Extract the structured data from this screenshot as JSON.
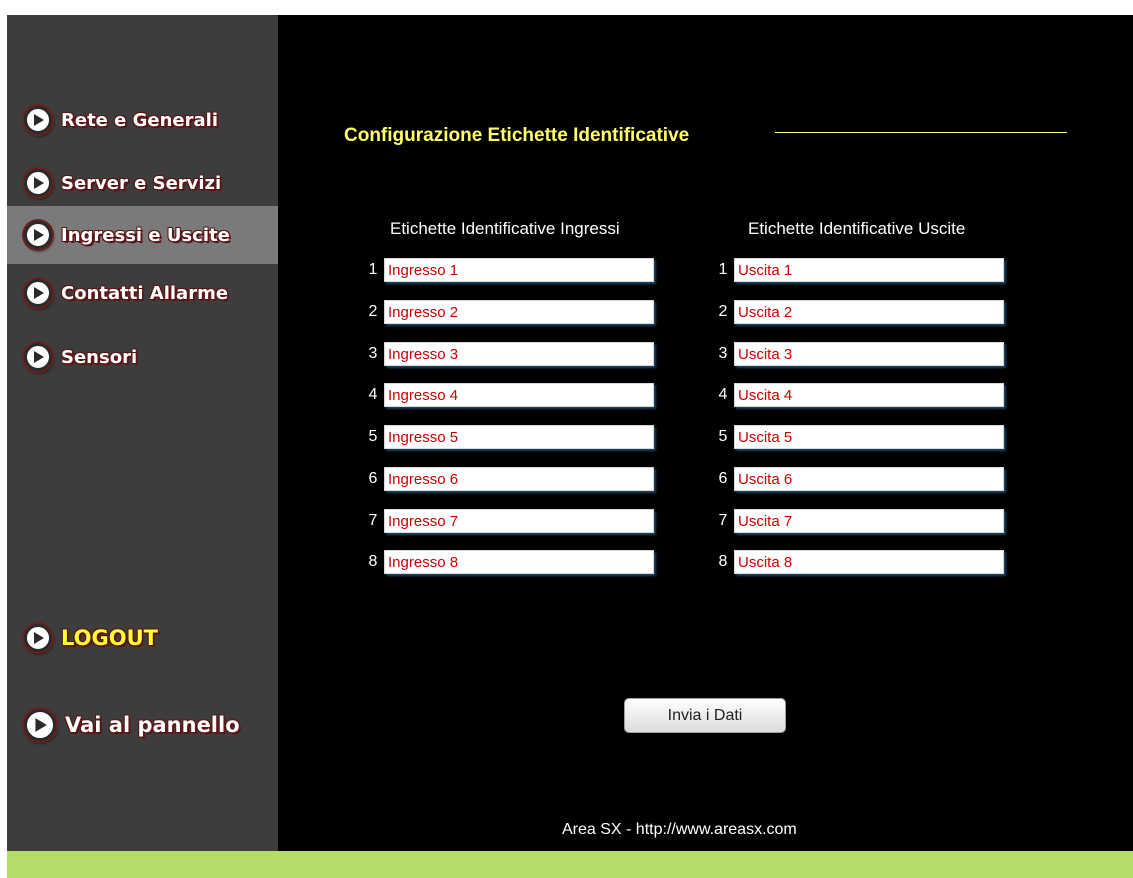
{
  "sidebar": {
    "items": [
      {
        "label": "Rete e Generali"
      },
      {
        "label": "Server e Servizi"
      },
      {
        "label": "Ingressi e Uscite",
        "active": true
      },
      {
        "label": "Contatti Allarme"
      },
      {
        "label": "Sensori"
      }
    ],
    "logout_label": "LOGOUT",
    "panel_label": "Vai al pannello",
    "icon": "circle-play-icon"
  },
  "main": {
    "title": "Configurazione Etichette Identificative",
    "inputs_heading": "Etichette Identificative Ingressi",
    "outputs_heading": "Etichette Identificative Uscite",
    "inputs": [
      {
        "num": "1",
        "value": "Ingresso 1"
      },
      {
        "num": "2",
        "value": "Ingresso 2"
      },
      {
        "num": "3",
        "value": "Ingresso 3"
      },
      {
        "num": "4",
        "value": "Ingresso 4"
      },
      {
        "num": "5",
        "value": "Ingresso 5"
      },
      {
        "num": "6",
        "value": "Ingresso 6"
      },
      {
        "num": "7",
        "value": "Ingresso 7"
      },
      {
        "num": "8",
        "value": "Ingresso 8"
      }
    ],
    "outputs": [
      {
        "num": "1",
        "value": "Uscita 1"
      },
      {
        "num": "2",
        "value": "Uscita 2"
      },
      {
        "num": "3",
        "value": "Uscita 3"
      },
      {
        "num": "4",
        "value": "Uscita 4"
      },
      {
        "num": "5",
        "value": "Uscita 5"
      },
      {
        "num": "6",
        "value": "Uscita 6"
      },
      {
        "num": "7",
        "value": "Uscita 7"
      },
      {
        "num": "8",
        "value": "Uscita 8"
      }
    ],
    "submit_label": "Invia i Dati"
  },
  "footer": {
    "text": "Area SX - http://www.areasx.com"
  },
  "colors": {
    "background": "#000000",
    "sidebar": "#3d3d3d",
    "sidebar_active": "#7a7a7a",
    "title": "#ffff66",
    "input_text": "#cc0000",
    "bottom_bar": "#b5dc6a"
  }
}
